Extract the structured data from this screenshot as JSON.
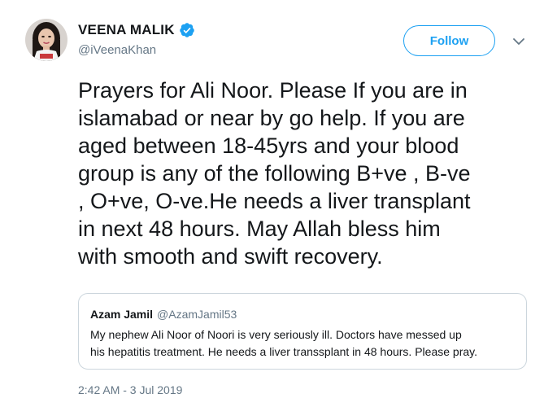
{
  "author": {
    "display_name": "VEENA MALIK",
    "handle": "@iVeenaKhan",
    "verified": true,
    "avatar": "profile-photo"
  },
  "follow_button": {
    "label": "Follow",
    "color": "#1da1f2"
  },
  "tweet": {
    "lines": [
      "Prayers for Ali Noor. Please If you are in",
      "islamabad or near by go help. If you are",
      "aged between 18-45yrs and your blood",
      "group is any of the following B+ve , B-ve",
      ", O+ve, O-ve.He needs a liver transplant",
      "in next 48 hours. May Allah bless him",
      "with smooth and swift recovery."
    ]
  },
  "quoted_tweet": {
    "author_name": "Azam Jamil",
    "author_handle": "@AzamJamil53",
    "lines": [
      "My nephew Ali Noor of Noori is very seriously ill. Doctors have messed up",
      "his hepatitis treatment. He needs a liver transsplant  in 48 hours. Please pray."
    ]
  },
  "timestamp": "2:42 AM - 3 Jul 2019",
  "icons": {
    "verified": "verified-badge-icon",
    "more": "chevron-down-icon"
  },
  "colors": {
    "accent": "#1da1f2",
    "text": "#14171a",
    "secondary_text": "#657786",
    "border": "#ccd6dd"
  }
}
